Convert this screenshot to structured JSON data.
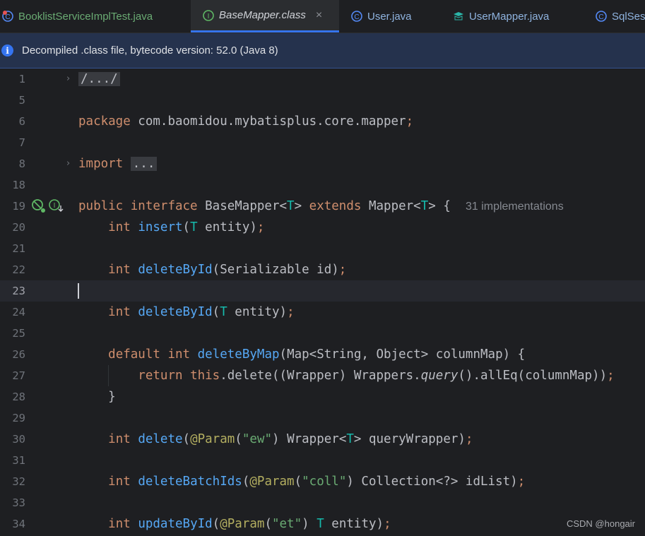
{
  "tabs": [
    {
      "label": "BooklistServiceImplTest.java",
      "icon": "test-class-icon"
    },
    {
      "label": "BaseMapper.class",
      "icon": "interface-icon",
      "close": "×"
    },
    {
      "label": "User.java",
      "icon": "class-icon"
    },
    {
      "label": "UserMapper.java",
      "icon": "mapper-icon"
    },
    {
      "label": "SqlSes",
      "icon": "class-icon"
    }
  ],
  "banner": {
    "icon": "i",
    "text": "Decompiled .class file, bytecode version: 52.0 (Java 8)"
  },
  "lines": {
    "n1": "1",
    "n5": "5",
    "n6": "6",
    "n7": "7",
    "n8": "8",
    "n18": "18",
    "n19": "19",
    "n20": "20",
    "n21": "21",
    "n22": "22",
    "n23": "23",
    "n24": "24",
    "n25": "25",
    "n26": "26",
    "n27": "27",
    "n28": "28",
    "n29": "29",
    "n30": "30",
    "n31": "31",
    "n32": "32",
    "n33": "33",
    "n34": "34"
  },
  "code": {
    "l1_fold": "/.../",
    "l6_kw": "package",
    "l6_rest": " com.baomidou.mybatisplus.core.mapper",
    "l6_semi": ";",
    "l8_kw": "import",
    "l8_fold": "...",
    "l19_kw1": "public",
    "l19_kw2": "interface",
    "l19_name": " BaseMapper<",
    "l19_t": "T",
    "l19_gt": "> ",
    "l19_kw3": "extends",
    "l19_sup": " Mapper<",
    "l19_t2": "T",
    "l19_end": "> {",
    "l19_hint": "31 implementations",
    "l20_kw": "int",
    "l20_fn": "insert",
    "l20_open": "(",
    "l20_t": "T",
    "l20_rest": " entity)",
    "l20_semi": ";",
    "l22_kw": "int",
    "l22_fn": "deleteById",
    "l22_rest": "(Serializable id)",
    "l22_semi": ";",
    "l24_kw": "int",
    "l24_fn": "deleteById",
    "l24_open": "(",
    "l24_t": "T",
    "l24_rest": " entity)",
    "l24_semi": ";",
    "l26_kw1": "default",
    "l26_kw2": "int",
    "l26_fn": "deleteByMap",
    "l26_rest": "(Map<String, Object> columnMap) {",
    "l27_kw1": "return",
    "l27_kw2": "this",
    "l27_a": ".delete((Wrapper) Wrappers.",
    "l27_it": "query",
    "l27_b": "().allEq(columnMap))",
    "l27_semi": ";",
    "l28": "}",
    "l30_kw": "int",
    "l30_fn": "delete",
    "l30_open": "(",
    "l30_ann": "@Param",
    "l30_p1": "(",
    "l30_str": "\"ew\"",
    "l30_p2": ") Wrapper<",
    "l30_t": "T",
    "l30_rest": "> queryWrapper)",
    "l30_semi": ";",
    "l32_kw": "int",
    "l32_fn": "deleteBatchIds",
    "l32_open": "(",
    "l32_ann": "@Param",
    "l32_p1": "(",
    "l32_str": "\"coll\"",
    "l32_rest": ") Collection<?> idList)",
    "l32_semi": ";",
    "l34_kw": "int",
    "l34_fn": "updateById",
    "l34_open": "(",
    "l34_ann": "@Param",
    "l34_p1": "(",
    "l34_str": "\"et\"",
    "l34_p2": ") ",
    "l34_t": "T",
    "l34_rest": " entity)",
    "l34_semi": ";"
  },
  "watermark": "CSDN @hongair",
  "colors": {
    "keyword": "#cf8e6d",
    "function": "#56a8f5",
    "type_param": "#16baac",
    "string": "#6aab73",
    "annotation": "#b3ae60",
    "accent": "#3574f0"
  }
}
